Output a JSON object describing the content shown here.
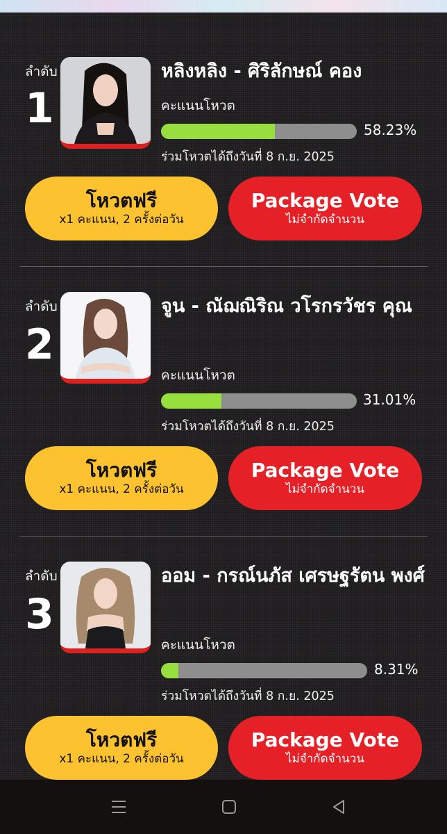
{
  "entries": [
    {
      "rank_label": "ลำดับ",
      "rank": "1",
      "name": "หลิงหลิง - ศิริลักษณ์ คอง",
      "score_label": "คะแนนโหวต",
      "percent": 58.23,
      "percent_text": "58.23%",
      "deadline": "ร่วมโหวตได้ถึงวันที่ 8 ก.ย. 2025",
      "free_vote": {
        "title": "โหวตฟรี",
        "subtitle": "x1 คะแนน, 2 ครั้งต่อวัน"
      },
      "package_vote": {
        "title": "Package Vote",
        "subtitle": "ไม่จำกัดจำนวน"
      }
    },
    {
      "rank_label": "ลำดับ",
      "rank": "2",
      "name": "จูน - ณัฌณิริณ วโรกรวัชร คุณ",
      "score_label": "คะแนนโหวต",
      "percent": 31.01,
      "percent_text": "31.01%",
      "deadline": "ร่วมโหวตได้ถึงวันที่ 8 ก.ย. 2025",
      "free_vote": {
        "title": "โหวตฟรี",
        "subtitle": "x1 คะแนน, 2 ครั้งต่อวัน"
      },
      "package_vote": {
        "title": "Package Vote",
        "subtitle": "ไม่จำกัดจำนวน"
      }
    },
    {
      "rank_label": "ลำดับ",
      "rank": "3",
      "name": "ออม - กรณ์นภัส เศรษฐรัตน พงศ์",
      "score_label": "คะแนนโหวต",
      "percent": 8.31,
      "percent_text": "8.31%",
      "deadline": "ร่วมโหวตได้ถึงวันที่ 8 ก.ย. 2025",
      "free_vote": {
        "title": "โหวตฟรี",
        "subtitle": "x1 คะแนน, 2 ครั้งต่อวัน"
      },
      "package_vote": {
        "title": "Package Vote",
        "subtitle": "ไม่จำกัดจำนวน"
      }
    }
  ],
  "colors": {
    "free_button": "#fcc22f",
    "package_button": "#e52027",
    "progress_fill": "#97df3f",
    "progress_track": "#8e8e8e",
    "photo_accent": "#e0201f"
  },
  "navbar": {
    "icons": [
      "menu-icon",
      "home-square-icon",
      "back-triangle-icon"
    ]
  }
}
